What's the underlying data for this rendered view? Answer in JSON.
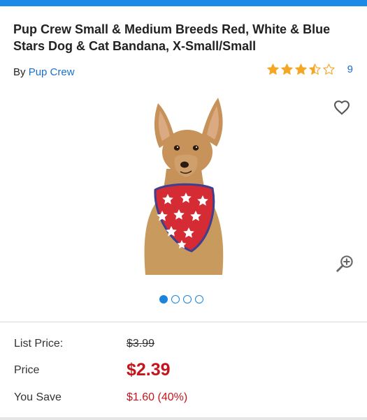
{
  "product": {
    "title": "Pup Crew Small & Medium Breeds Red, White & Blue Stars Dog & Cat Bandana, X-Small/Small",
    "by_prefix": "By",
    "brand": "Pup Crew",
    "rating": 3.5,
    "rating_max": 5,
    "review_count": "9",
    "image_name": "dog-wearing-star-bandana"
  },
  "carousel": {
    "count": 4,
    "active_index": 0
  },
  "icons": {
    "favorite": "heart-outline-icon",
    "zoom": "zoom-in-icon",
    "star_color": "#f5a623"
  },
  "pricing": {
    "list_label": "List Price:",
    "list_value": "$3.99",
    "price_label": "Price",
    "price_value": "$2.39",
    "save_label": "You Save",
    "save_value": "$1.60 (40%)"
  },
  "colors": {
    "accent": "#1c8ae6",
    "link": "#1a6fc9",
    "sale": "#c4151c"
  }
}
